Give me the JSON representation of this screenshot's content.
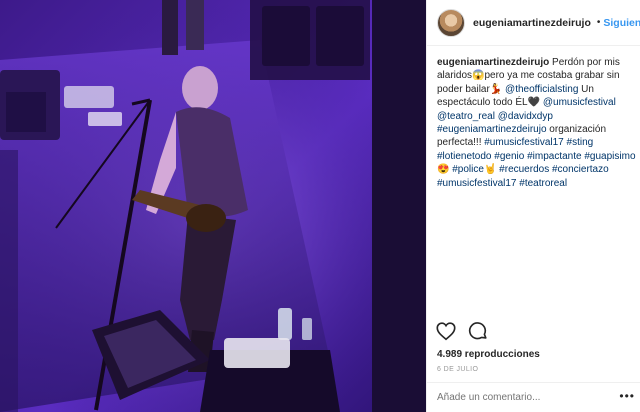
{
  "post": {
    "username": "eugeniamartinezdeirujo",
    "follow_label": "Siguiendo",
    "separator": "•",
    "caption": {
      "username": "eugeniamartinezdeirujo",
      "parts": [
        {
          "t": "text",
          "v": " Perdón por mis alaridos😱pero ya me costaba grabar sin poder bailar💃 "
        },
        {
          "t": "tag",
          "v": "@theofficialsting"
        },
        {
          "t": "text",
          "v": " Un espectáculo todo ÉL🖤 "
        },
        {
          "t": "tag",
          "v": "@umusicfestival"
        },
        {
          "t": "text",
          "v": " "
        },
        {
          "t": "tag",
          "v": "@teatro_real"
        },
        {
          "t": "text",
          "v": " "
        },
        {
          "t": "tag",
          "v": "@davidxdyp"
        },
        {
          "t": "text",
          "v": " "
        },
        {
          "t": "tag",
          "v": "#eugeniamartinezdeirujo"
        },
        {
          "t": "text",
          "v": " organización perfecta!!! "
        },
        {
          "t": "tag",
          "v": "#umusicfestival17"
        },
        {
          "t": "text",
          "v": " "
        },
        {
          "t": "tag",
          "v": "#sting"
        },
        {
          "t": "text",
          "v": " "
        },
        {
          "t": "tag",
          "v": "#lotienetodo"
        },
        {
          "t": "text",
          "v": " "
        },
        {
          "t": "tag",
          "v": "#genio"
        },
        {
          "t": "text",
          "v": " "
        },
        {
          "t": "tag",
          "v": "#impactante"
        },
        {
          "t": "text",
          "v": " "
        },
        {
          "t": "tag",
          "v": "#guapisimo"
        },
        {
          "t": "text",
          "v": "😍 "
        },
        {
          "t": "tag",
          "v": "#police"
        },
        {
          "t": "text",
          "v": "🤘 "
        },
        {
          "t": "tag",
          "v": "#recuerdos"
        },
        {
          "t": "text",
          "v": " "
        },
        {
          "t": "tag",
          "v": "#conciertazo"
        },
        {
          "t": "text",
          "v": " "
        },
        {
          "t": "tag",
          "v": "#umusicfestival17"
        },
        {
          "t": "text",
          "v": " "
        },
        {
          "t": "tag",
          "v": "#teatroreal"
        }
      ]
    },
    "views": "4.989 reproducciones",
    "date": "6 DE JULIO",
    "comment_placeholder": "Añade un comentario...",
    "more_label": "•••"
  },
  "icons": {
    "verified": "verified-badge-icon",
    "like": "heart-icon",
    "comment": "comment-bubble-icon",
    "more": "more-options-icon"
  },
  "colors": {
    "link": "#003569",
    "follow": "#3897f0",
    "verified": "#3897f0",
    "stage": "#7a3fd6"
  }
}
